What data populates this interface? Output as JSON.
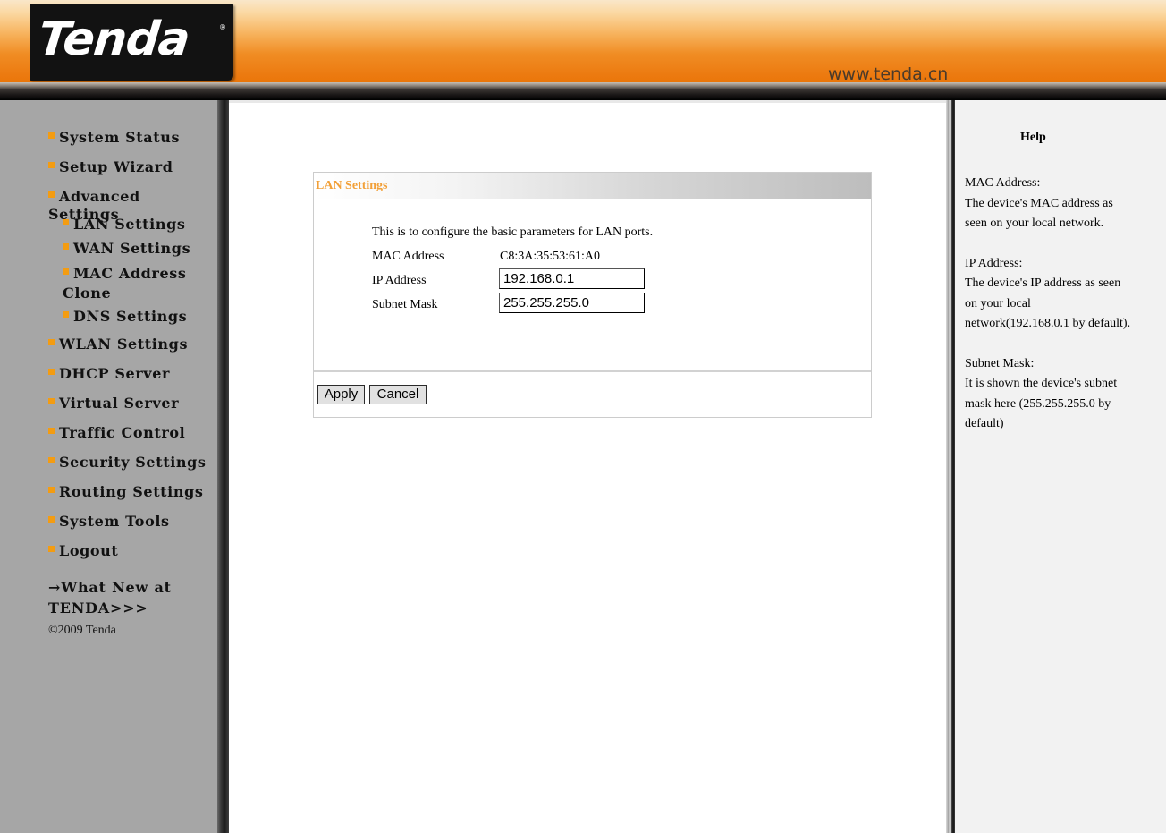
{
  "header": {
    "logo_text": "Tenda",
    "logo_reg": "®",
    "site_url": "www.tenda.cn"
  },
  "sidebar": {
    "items": [
      {
        "label": "System Status"
      },
      {
        "label": "Setup Wizard"
      },
      {
        "label": "Advanced Settings"
      },
      {
        "label": "LAN Settings",
        "sub": true
      },
      {
        "label": "WAN Settings",
        "sub": true
      },
      {
        "label": "MAC Address Clone",
        "sub": true
      },
      {
        "label": "DNS Settings",
        "sub": true
      },
      {
        "label": "WLAN Settings"
      },
      {
        "label": "DHCP Server"
      },
      {
        "label": "Virtual Server"
      },
      {
        "label": "Traffic Control"
      },
      {
        "label": "Security Settings"
      },
      {
        "label": "Routing Settings"
      },
      {
        "label": "System Tools"
      },
      {
        "label": "Logout"
      }
    ],
    "whats_new": "→What New at TENDA>>>",
    "copyright": "©2009 Tenda"
  },
  "main": {
    "panel_title": "LAN Settings",
    "description": "This is to configure the basic parameters for LAN ports.",
    "mac_label": "MAC Address",
    "mac_value": "C8:3A:35:53:61:A0",
    "ip_label": "IP Address",
    "ip_value": "192.168.0.1",
    "mask_label": "Subnet Mask",
    "mask_value": "255.255.255.0",
    "apply_label": "Apply",
    "cancel_label": "Cancel"
  },
  "help": {
    "title": "Help",
    "sections": [
      {
        "heading": "MAC Address:",
        "text": "The device's MAC address as seen on your local network."
      },
      {
        "heading": "IP Address:",
        "text": "The device's IP address as seen on your local network(192.168.0.1 by default)."
      },
      {
        "heading": "Subnet Mask:",
        "text": "It is shown the device's subnet mask here (255.255.255.0 by default)"
      }
    ]
  },
  "colors": {
    "accent_orange": "#f39c12",
    "panel_title": "#f2a038",
    "sidebar_bg": "#a6a6a6",
    "help_bg": "#f2f2f2"
  }
}
